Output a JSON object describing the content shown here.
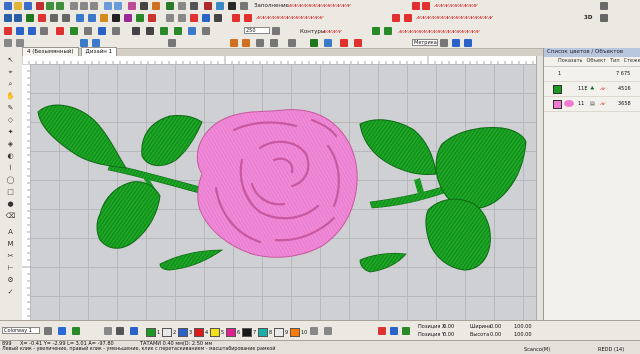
{
  "toolbar": {
    "fill_label": "Заполнение",
    "contours_label": "Контуры",
    "zoom_value": "250",
    "metric_label": "Метрика"
  },
  "tabs": [
    {
      "label": "4 (Безымянный)"
    },
    {
      "label": "Дизайн 1"
    }
  ],
  "right_panel": {
    "title": "Список цветов / Объектов",
    "columns": [
      "Показать",
      "Объект",
      "Тип",
      "Стежки"
    ],
    "rows": [
      {
        "num": "1",
        "stitches": "7 675",
        "color": "#ffffff"
      },
      {
        "num": "2",
        "id": "11Е",
        "stitches": "4516",
        "color": "#1a9a22"
      },
      {
        "num": "3",
        "id": "11",
        "stitches": "3658",
        "color": "#f07bd0"
      }
    ]
  },
  "bottom": {
    "colorway": "Colorway 1",
    "thread_numbers": [
      "1",
      "2",
      "3",
      "4",
      "5",
      "6",
      "7",
      "8",
      "9",
      "10"
    ],
    "thread_colors": [
      "#1a9a22",
      "#e8e8e8",
      "#2a62c8",
      "#e01818",
      "#f3e21a",
      "#e02090",
      "#1a1a1a",
      "#18b0a8",
      "#e8e8e8",
      "#ff7a00"
    ],
    "position_x_label": "Позиция X",
    "position_y_label": "Позиция Y",
    "width_label": "Ширина",
    "height_label": "Высота",
    "zero_value": "0.00",
    "mm_value": "100.00"
  },
  "status": {
    "coords": "X= -0.41 Y= -2.99 L= 3.01 A= -97.80",
    "tatami": "ТАТАМИ 0.40 мм(D: 2.50 мм",
    "hint": "Левый клик - увеличение, правый клик - уменьшение, клик с перетаскиванием - масштабирование рамкой",
    "machine": "Scanco(M)",
    "status_code": "REDD (14)",
    "zoom": "899"
  },
  "colors": {
    "rose_pink": "#f08ad8",
    "rose_shadow": "#c8589f",
    "leaf_green": "#1fa828",
    "leaf_dark": "#0e6a14"
  }
}
